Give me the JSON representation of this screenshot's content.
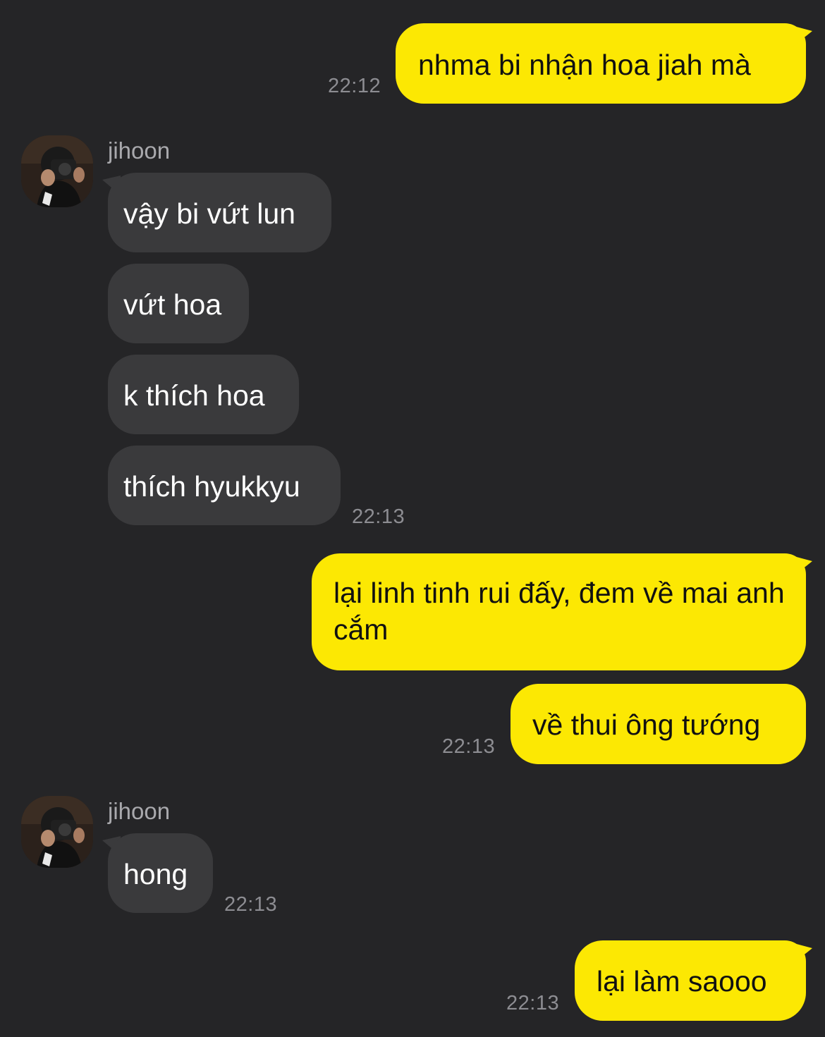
{
  "chat": {
    "messages": [
      {
        "from": "me",
        "text": "nhma bi nhận hoa jiah mà",
        "time": "22:12"
      },
      {
        "from": "jihoon",
        "sender": "jihoon",
        "text": "vậy bi vứt lun"
      },
      {
        "from": "jihoon",
        "text": "vứt hoa"
      },
      {
        "from": "jihoon",
        "text": "k thích hoa"
      },
      {
        "from": "jihoon",
        "text": "thích hyukkyu",
        "time": "22:13"
      },
      {
        "from": "me",
        "text": "lại linh tinh rui đấy, đem về mai anh cắm"
      },
      {
        "from": "me",
        "text": "về thui ông tướng",
        "time": "22:13"
      },
      {
        "from": "jihoon",
        "sender": "jihoon",
        "text": "hong",
        "time": "22:13"
      },
      {
        "from": "me",
        "text": "lại làm saooo",
        "time": "22:13"
      }
    ]
  },
  "colors": {
    "background": "#252527",
    "outgoing_bubble": "#fce803",
    "incoming_bubble": "#3a3a3c",
    "timestamp": "#8d8d92"
  }
}
